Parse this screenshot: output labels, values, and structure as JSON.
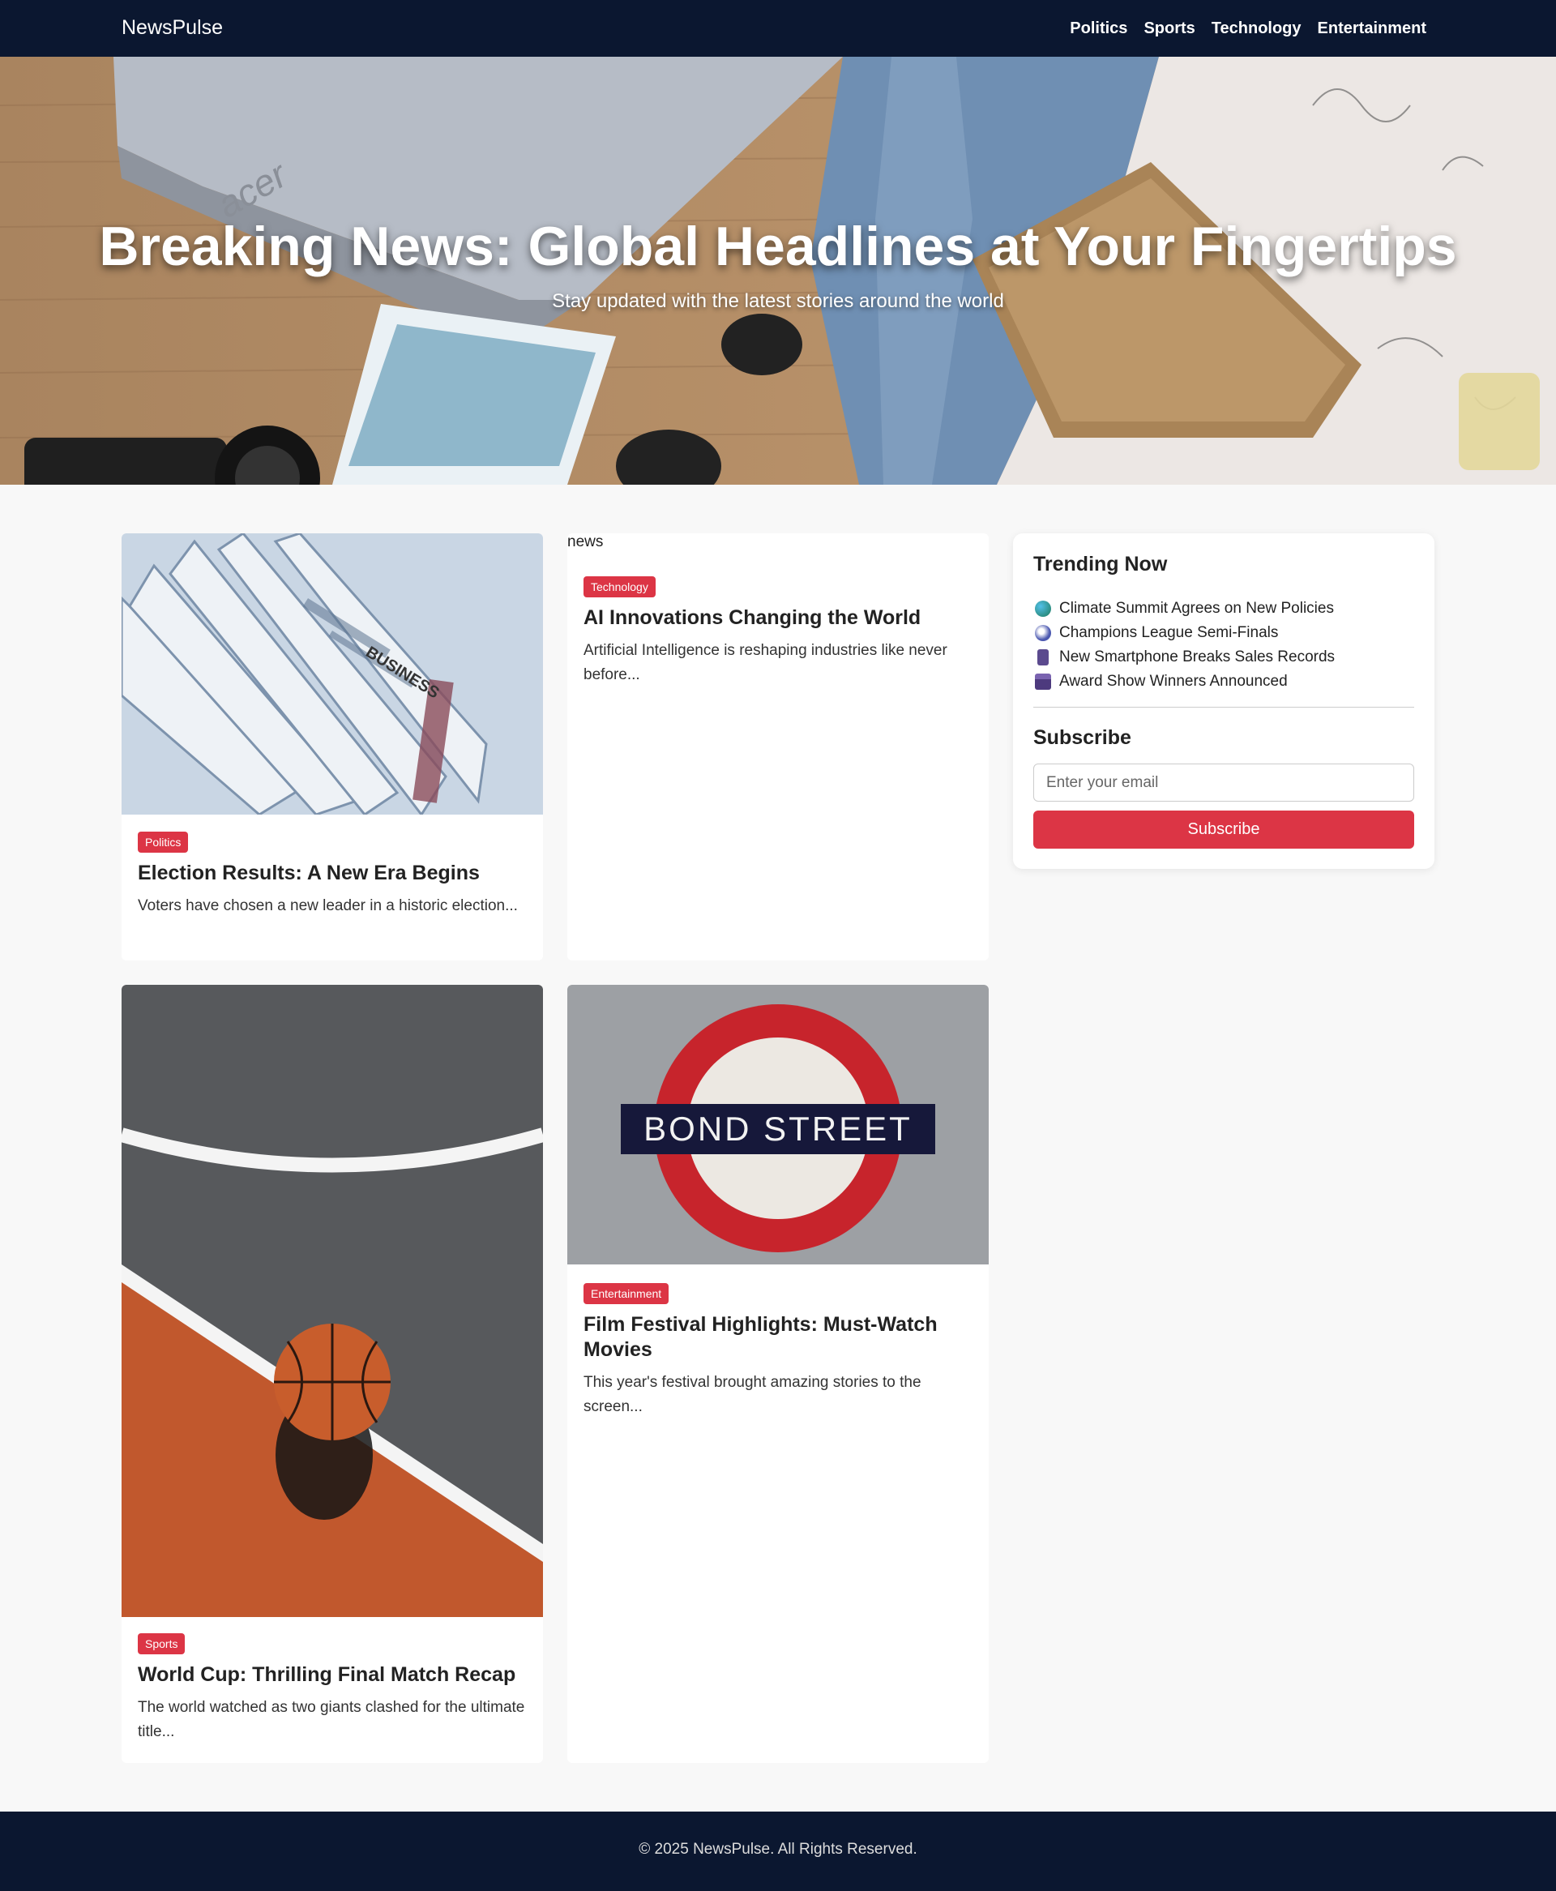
{
  "nav": {
    "brand": "NewsPulse",
    "links": [
      "Politics",
      "Sports",
      "Technology",
      "Entertainment"
    ]
  },
  "hero": {
    "title": "Breaking News: Global Headlines at Your Fingertips",
    "subtitle": "Stay updated with the latest stories around the world"
  },
  "articles": [
    {
      "category": "Politics",
      "title": "Election Results: A New Era Begins",
      "excerpt": "Voters have chosen a new leader in a historic election..."
    },
    {
      "image_alt": "news",
      "category": "Technology",
      "title": "AI Innovations Changing the World",
      "excerpt": "Artificial Intelligence is reshaping industries like never before..."
    },
    {
      "category": "Sports",
      "title": "World Cup: Thrilling Final Match Recap",
      "excerpt": "The world watched as two giants clashed for the ultimate title..."
    },
    {
      "category": "Entertainment",
      "title": "Film Festival Highlights: Must-Watch Movies",
      "excerpt": "This year's festival brought amazing stories to the screen...",
      "sign_text": "BOND STREET"
    }
  ],
  "sidebar": {
    "trending_title": "Trending Now",
    "trending": [
      {
        "icon": "globe-icon",
        "label": "Climate Summit Agrees on New Policies"
      },
      {
        "icon": "soccer-ball-icon",
        "label": "Champions League Semi-Finals"
      },
      {
        "icon": "smartphone-icon",
        "label": "New Smartphone Breaks Sales Records"
      },
      {
        "icon": "clapperboard-icon",
        "label": "Award Show Winners Announced"
      }
    ],
    "subscribe_title": "Subscribe",
    "email_placeholder": "Enter your email",
    "subscribe_button": "Subscribe"
  },
  "footer": {
    "text": "© 2025 NewsPulse. All Rights Reserved."
  },
  "colors": {
    "nav_bg": "#0b1730",
    "accent": "#dc3545",
    "page_bg": "#f8f8f8"
  }
}
